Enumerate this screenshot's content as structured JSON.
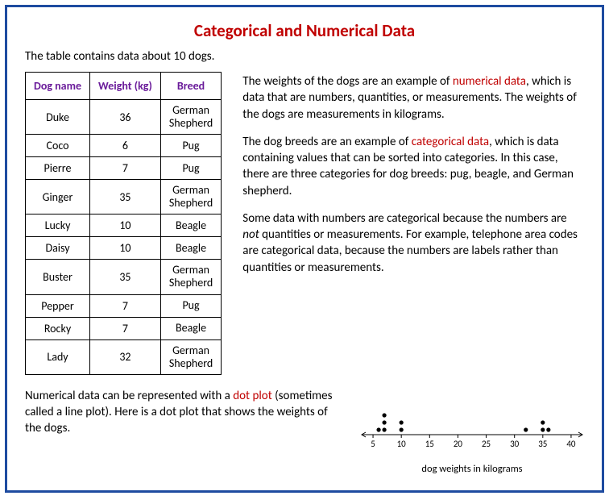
{
  "title": "Categorical and Numerical Data",
  "intro": "The table contains data about 10 dogs.",
  "table": {
    "headers": [
      "Dog name",
      "Weight (kg)",
      "Breed"
    ],
    "rows": [
      {
        "name": "Duke",
        "weight": "36",
        "breed": "German Shepherd"
      },
      {
        "name": "Coco",
        "weight": "6",
        "breed": "Pug"
      },
      {
        "name": "Pierre",
        "weight": "7",
        "breed": "Pug"
      },
      {
        "name": "Ginger",
        "weight": "35",
        "breed": "German Shepherd"
      },
      {
        "name": "Lucky",
        "weight": "10",
        "breed": "Beagle"
      },
      {
        "name": "Daisy",
        "weight": "10",
        "breed": "Beagle"
      },
      {
        "name": "Buster",
        "weight": "35",
        "breed": "German Shepherd"
      },
      {
        "name": "Pepper",
        "weight": "7",
        "breed": "Pug"
      },
      {
        "name": "Rocky",
        "weight": "7",
        "breed": "Beagle"
      },
      {
        "name": "Lady",
        "weight": "32",
        "breed": "German Shepherd"
      }
    ]
  },
  "para1_a": "The weights of the dogs are an example of ",
  "para1_red": "numerical data",
  "para1_b": ", which is data that are numbers, quantities, or measurements. The weights of the dogs are measurements in kilograms.",
  "para2_a": "The dog breeds are an example of ",
  "para2_red": "categorical data",
  "para2_b": ", which is data containing values that can be sorted into categories. In this case, there are three categories for dog breeds: pug, beagle, and German shepherd.",
  "para3_a": "Some data with numbers are categorical because the numbers are ",
  "para3_it": "not",
  "para3_b": " quantities or measurements. For example, telephone area codes are categorical data, because the numbers are labels rather than quantities or measurements.",
  "bottom_a": "Numerical data can be represented with a ",
  "bottom_red": "dot plot",
  "bottom_b": " (sometimes called a line plot). Here is a dot plot that shows the weights of the dogs.",
  "chart_data": {
    "type": "dotplot",
    "xlabel": "dog weights in kilograms",
    "ticks": [
      5,
      10,
      15,
      20,
      25,
      30,
      35,
      40
    ],
    "points": [
      {
        "x": 6,
        "count": 1
      },
      {
        "x": 7,
        "count": 3
      },
      {
        "x": 10,
        "count": 2
      },
      {
        "x": 32,
        "count": 1
      },
      {
        "x": 35,
        "count": 2
      },
      {
        "x": 36,
        "count": 1
      }
    ],
    "xmin": 3,
    "xmax": 42
  }
}
